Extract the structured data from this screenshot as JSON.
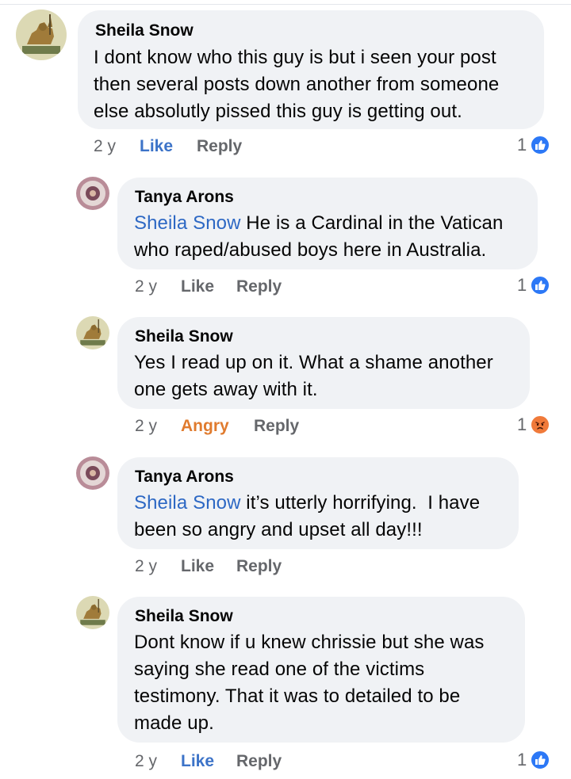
{
  "comments": [
    {
      "author": "Sheila Snow",
      "mention": "",
      "lines": [
        "I dont know who this guy is but i seen your post",
        "then several posts down another from someone",
        "else absolutly pissed this guy is getting out."
      ],
      "time": "2 y",
      "reaction_label": "Like",
      "reply_label": "Reply",
      "reaction_count": "1",
      "reaction_icon": "like-icon"
    },
    {
      "author": "Tanya Arons",
      "mention": "Sheila Snow",
      "lines": [
        " He is a Cardinal in the Vatican",
        "who raped/abused boys here in Australia."
      ],
      "time": "2 y",
      "reaction_label": "Like",
      "reply_label": "Reply",
      "reaction_count": "1",
      "reaction_icon": "like-icon"
    },
    {
      "author": "Sheila Snow",
      "mention": "",
      "lines": [
        "Yes I read up on it. What a shame another",
        "one gets away with it."
      ],
      "time": "2 y",
      "reaction_label": "Angry",
      "reply_label": "Reply",
      "reaction_count": "1",
      "reaction_icon": "angry-icon"
    },
    {
      "author": "Tanya Arons",
      "mention": "Sheila Snow",
      "lines": [
        " it’s utterly horrifying.  I have",
        "been so angry and upset all day!!!"
      ],
      "time": "2 y",
      "reaction_label": "Like",
      "reply_label": "Reply",
      "reaction_count": "",
      "reaction_icon": ""
    },
    {
      "author": "Sheila Snow",
      "mention": "",
      "lines": [
        "Dont know if u knew chrissie but she was",
        "saying she read one of the victims",
        "testimony. That it was to detailed to be",
        "made up."
      ],
      "time": "2 y",
      "reaction_label": "Like",
      "reply_label": "Reply",
      "reaction_count": "1",
      "reaction_icon": "like-icon"
    }
  ],
  "colors": {
    "bubble": "#f0f2f5",
    "mention": "#2d68c4",
    "liked": "#3c73c8",
    "angry": "#e07b2e",
    "muted": "#65676b"
  }
}
